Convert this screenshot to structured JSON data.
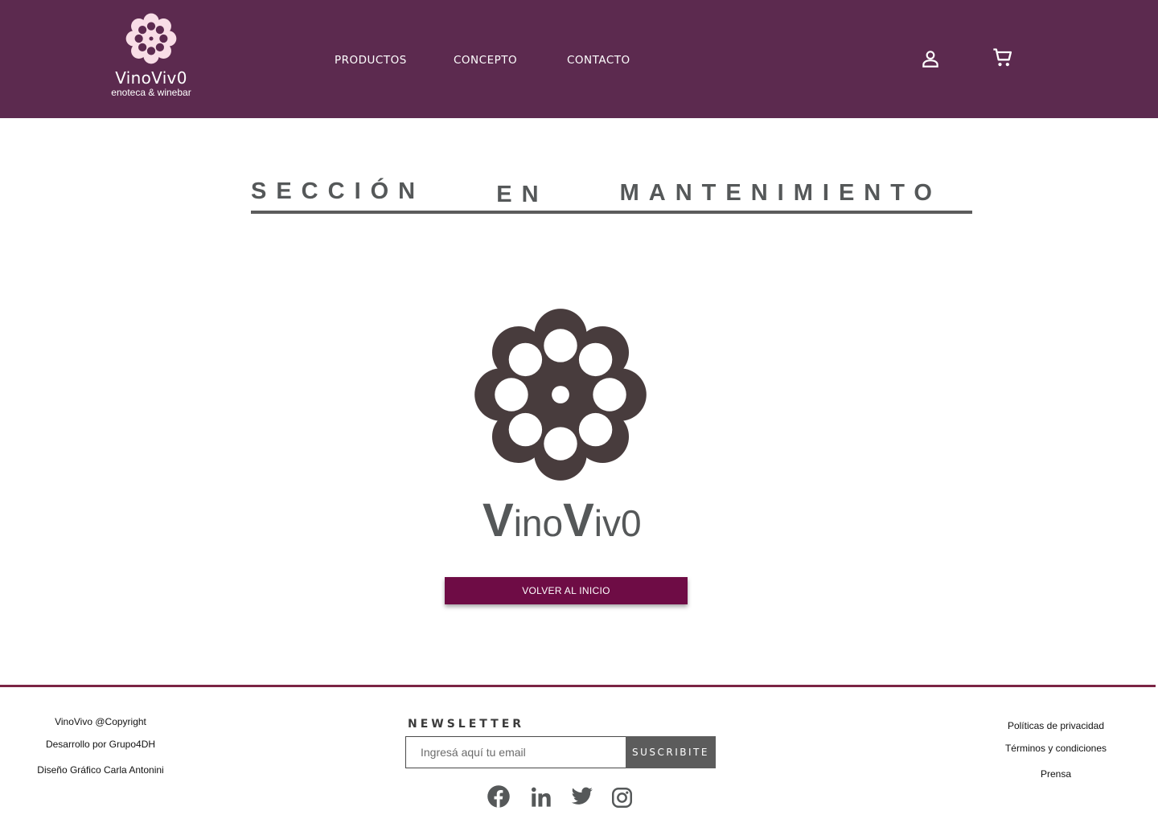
{
  "brand": {
    "name": "VinoViv0",
    "tagline": "enoteca & winebar",
    "name_parts": [
      "V",
      "ino",
      "V",
      "iv0"
    ]
  },
  "nav": {
    "items": [
      "PRODUCTOS",
      "CONCEPTO",
      "CONTACTO"
    ]
  },
  "header_icons": [
    "user-icon",
    "cart-icon"
  ],
  "main": {
    "title_words": [
      "SECCIÓN",
      "EN",
      "MANTENIMIENTO"
    ],
    "home_button": "VOLVER AL INICIO"
  },
  "footer": {
    "left": [
      "VinoVivo @Copyright",
      "Desarrollo por Grupo4DH",
      "Diseño Gráfico Carla Antonini"
    ],
    "newsletter": {
      "title": "NEWSLETTER",
      "placeholder": "Ingresá aquí tu email",
      "button": "SUSCRIBITE"
    },
    "social": [
      "facebook-icon",
      "linkedin-icon",
      "twitter-icon",
      "instagram-icon"
    ],
    "right": [
      "Políticas de privacidad",
      "Términos y condiciones",
      "Prensa"
    ]
  },
  "colors": {
    "header_bg": "#5c2a4f",
    "logo_pink": "#f8dde6",
    "accent_button": "#6e0c45",
    "footer_line": "#7b2444",
    "gray_text": "#555859",
    "logo_dark": "#483c3d"
  }
}
